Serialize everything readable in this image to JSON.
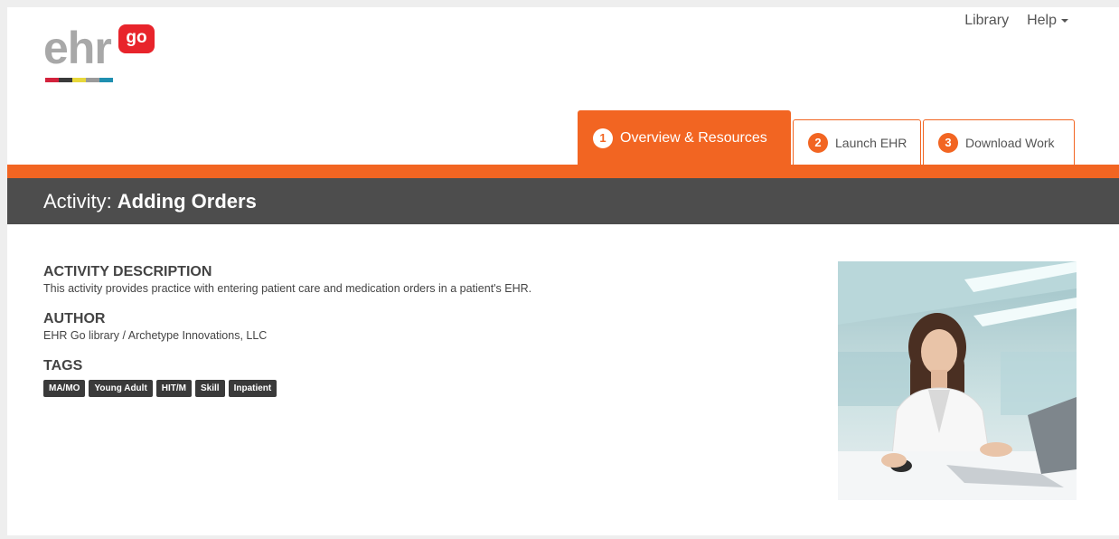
{
  "logo": {
    "word": "ehr",
    "badge": "go",
    "stripe_colors": [
      "#d3223c",
      "#3a3a3a",
      "#e8d83a",
      "#9a9a9a",
      "#1f8fb0"
    ]
  },
  "topnav": {
    "library": "Library",
    "help": "Help"
  },
  "tabs": [
    {
      "num": "1",
      "label": "Overview & Resources"
    },
    {
      "num": "2",
      "label": "Launch EHR"
    },
    {
      "num": "3",
      "label": "Download Work"
    }
  ],
  "activity": {
    "prefix": "Activity:",
    "name": "Adding Orders"
  },
  "sections": {
    "description_heading": "ACTIVITY DESCRIPTION",
    "description_text": "This activity provides practice with entering patient care and medication orders in a patient's EHR.",
    "author_heading": "AUTHOR",
    "author_text": "EHR Go library / Archetype Innovations, LLC",
    "tags_heading": "TAGS"
  },
  "tags": [
    "MA/MO",
    "Young Adult",
    "HIT/M",
    "Skill",
    "Inpatient"
  ],
  "colors": {
    "accent": "#f26522",
    "title_bar": "#4d4d4d"
  }
}
